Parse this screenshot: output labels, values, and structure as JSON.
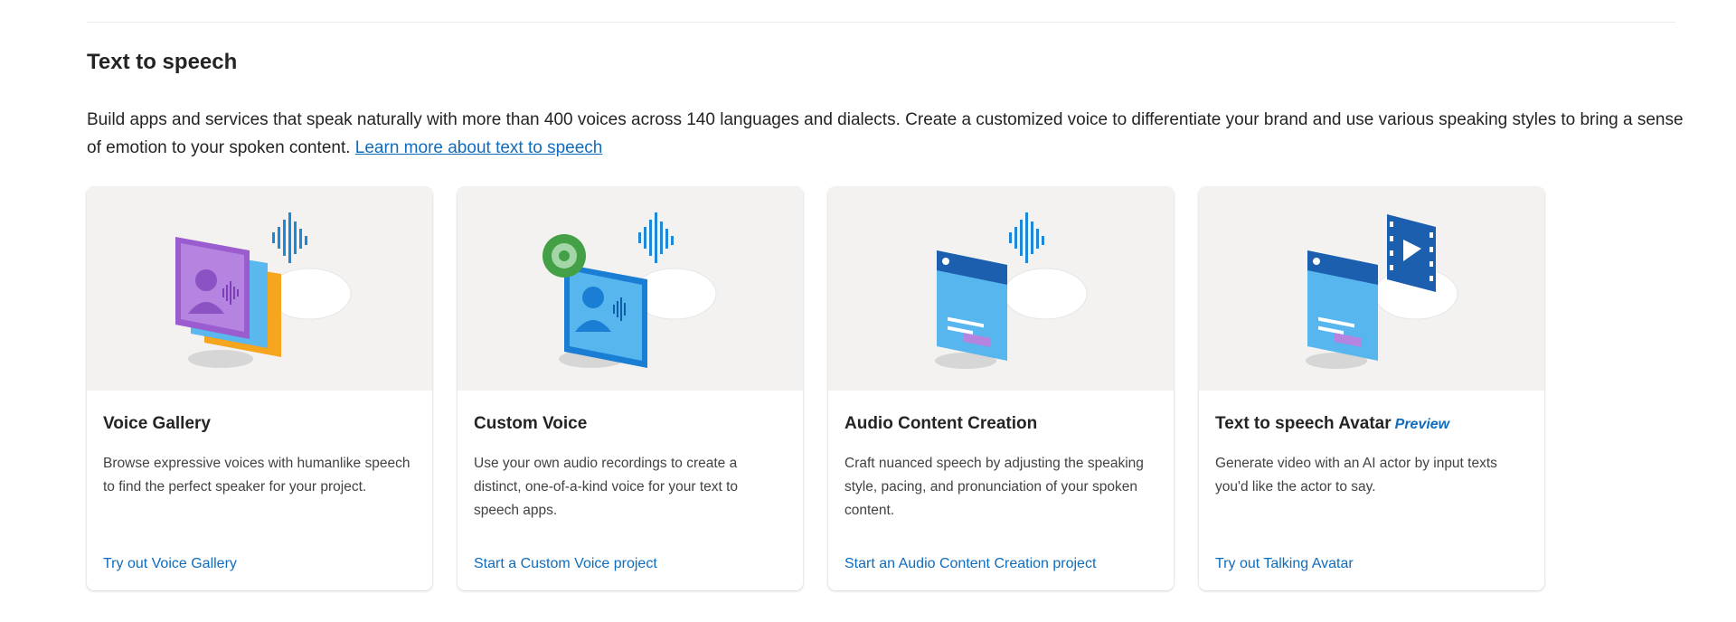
{
  "section": {
    "title": "Text to speech",
    "description": "Build apps and services that speak naturally with more than 400 voices across 140 languages and dialects. Create a customized voice to differentiate your brand and use various speaking styles to bring a sense of emotion to your spoken content.",
    "learn_more_link": "Learn more about text to speech"
  },
  "cards": [
    {
      "title": "Voice Gallery",
      "description": "Browse expressive voices with humanlike speech to find the perfect speaker for your project.",
      "link": "Try out Voice Gallery",
      "icon": "voice-gallery-illustration"
    },
    {
      "title": "Custom Voice",
      "description": "Use your own audio recordings to create a distinct, one-of-a-kind voice for your text to speech apps.",
      "link": "Start a Custom Voice project",
      "icon": "custom-voice-illustration"
    },
    {
      "title": "Audio Content Creation",
      "description": "Craft nuanced speech by adjusting the speaking style, pacing, and pronunciation of your spoken content.",
      "link": "Start an Audio Content Creation project",
      "icon": "audio-content-creation-illustration"
    },
    {
      "title": "Text to speech Avatar",
      "badge": "Preview",
      "description": "Generate video with an AI actor by input texts you'd like the actor to say.",
      "link": "Try out Talking Avatar",
      "icon": "talking-avatar-illustration"
    }
  ],
  "colors": {
    "link": "#0f6cbd",
    "card_image_bg": "#f3f2f1",
    "text": "#242424"
  }
}
